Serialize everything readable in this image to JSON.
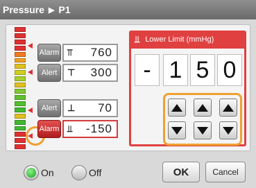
{
  "title": {
    "screen": "Pressure",
    "separator": "▶",
    "param": "P1"
  },
  "level_bar": {
    "segment_colors": [
      "#e03030",
      "#e03030",
      "#e03030",
      "#e03030",
      "#f07a20",
      "#f0a020",
      "#e0c020",
      "#d0cf20",
      "#a8d030",
      "#e0c020",
      "#80c830",
      "#60c030",
      "#50c030",
      "#40b830",
      "#e0c020",
      "#40b830",
      "#40b830",
      "#e03030",
      "#e03030",
      "#e03030"
    ]
  },
  "limits": [
    {
      "alarm_label": "Alarm",
      "icon": "⫪",
      "value": "760",
      "alarm_active": false
    },
    {
      "alarm_label": "Alert",
      "icon": "⊤",
      "value": "300",
      "alarm_active": false
    },
    {
      "alarm_label": "Alert",
      "icon": "⊥",
      "value": "70",
      "alarm_active": false
    },
    {
      "alarm_label": "Alarm",
      "icon": "⫫",
      "value": "-150",
      "alarm_active": true
    }
  ],
  "editor": {
    "icon": "⫫",
    "title": "Lower Limit (mmHg)",
    "digits": [
      "-",
      "1",
      "5",
      "0"
    ]
  },
  "bottom": {
    "on_label": "On",
    "off_label": "Off",
    "on_selected": true,
    "ok_label": "OK",
    "cancel_label": "Cancel"
  },
  "colors": {
    "accent_red": "#e04040",
    "highlight_orange": "#f0a030",
    "title_gray": "#7a7a7a"
  }
}
